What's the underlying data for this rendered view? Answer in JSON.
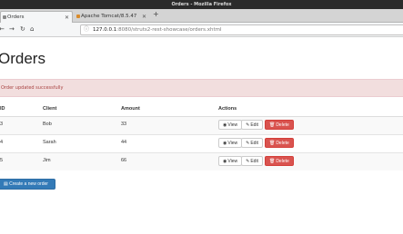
{
  "window": {
    "title": "Orders - Mozilla Firefox"
  },
  "tabs": [
    {
      "label": "Orders",
      "active": true,
      "icon": "page-icon"
    },
    {
      "label": "Apache Tomcat/8.5.47",
      "active": false,
      "icon": "tomcat-icon"
    }
  ],
  "nav": {
    "url_host": "127.0.0.1",
    "url_rest": ":8080/struts2-rest-showcase/orders.xhtml"
  },
  "page": {
    "title": "Orders",
    "alert": "Order updated successfully"
  },
  "table": {
    "headers": [
      "ID",
      "Client",
      "Amount",
      "Actions"
    ],
    "rows": [
      {
        "id": "3",
        "client": "Bob",
        "amount": "33"
      },
      {
        "id": "4",
        "client": "Sarah",
        "amount": "44"
      },
      {
        "id": "5",
        "client": "Jim",
        "amount": "66"
      }
    ],
    "actions": {
      "view": "View",
      "edit": "Edit",
      "delete": "Delete"
    }
  },
  "create_button": "Create a new order",
  "colors": {
    "alert_bg": "#f2dede",
    "alert_text": "#a94442",
    "danger": "#d9534f",
    "primary": "#337ab7"
  }
}
